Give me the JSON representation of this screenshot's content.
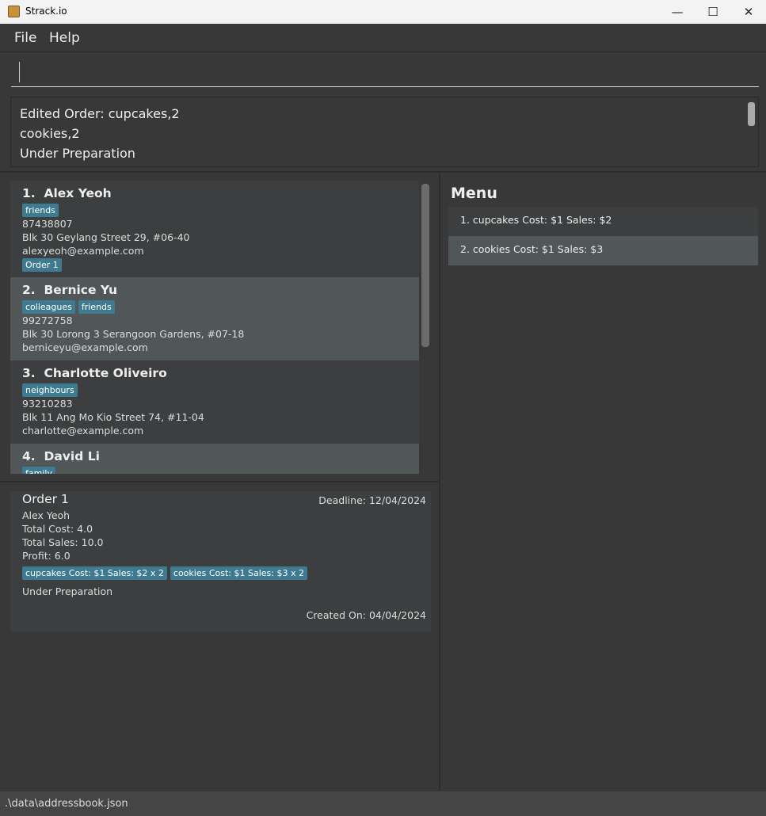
{
  "window": {
    "title": "Strack.io",
    "minimize": "—",
    "maximize": "☐",
    "close": "✕"
  },
  "menu": {
    "file": "File",
    "help": "Help"
  },
  "command": {
    "value": "",
    "placeholder": ""
  },
  "result": {
    "lines": [
      "Edited Order: cupcakes,2",
      "cookies,2",
      "Under Preparation"
    ]
  },
  "persons": [
    {
      "index": "1.",
      "name": "Alex Yeoh",
      "tags": [
        "friends"
      ],
      "phone": "87438807",
      "address": "Blk 30 Geylang Street 29, #06-40",
      "email": "alexyeoh@example.com",
      "orders": [
        "Order 1"
      ]
    },
    {
      "index": "2.",
      "name": "Bernice Yu",
      "tags": [
        "colleagues",
        "friends"
      ],
      "phone": "99272758",
      "address": "Blk 30 Lorong 3 Serangoon Gardens, #07-18",
      "email": "berniceyu@example.com"
    },
    {
      "index": "3.",
      "name": "Charlotte Oliveiro",
      "tags": [
        "neighbours"
      ],
      "phone": "93210283",
      "address": "Blk 11 Ang Mo Kio Street 74, #11-04",
      "email": "charlotte@example.com"
    },
    {
      "index": "4.",
      "name": "David Li",
      "tags": [
        "family"
      ]
    }
  ],
  "order": {
    "title": "Order 1",
    "deadline": "Deadline: 12/04/2024",
    "customer": "Alex Yeoh",
    "total_cost": "Total Cost: 4.0",
    "total_sales": "Total Sales: 10.0",
    "profit": "Profit: 6.0",
    "items": [
      "cupcakes Cost: $1 Sales: $2 x 2",
      "cookies Cost: $1 Sales: $3 x 2"
    ],
    "status": "Under Preparation",
    "created": "Created On: 04/04/2024"
  },
  "product_menu": {
    "title": "Menu",
    "items": [
      {
        "label": "1. cupcakes  Cost: $1  Sales: $2"
      },
      {
        "label": "2. cookies  Cost: $1  Sales: $3"
      }
    ]
  },
  "status_bar": {
    "path": ".\\data\\addressbook.json"
  },
  "colors": {
    "tag": "#3e7b91",
    "background": "#383838",
    "card": "#3c3e3f",
    "card_selected": "#515658"
  }
}
